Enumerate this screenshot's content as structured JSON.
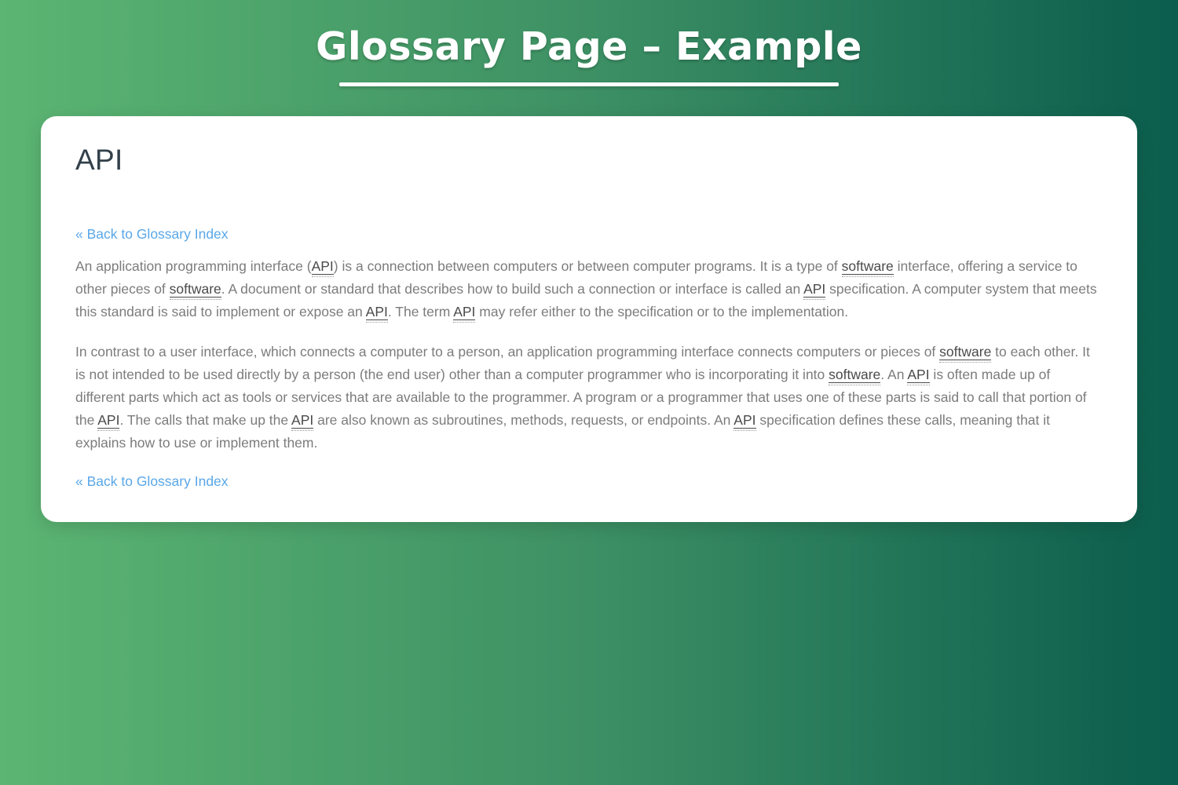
{
  "header": {
    "title": "Glossary Page – Example"
  },
  "theme": {
    "gradient_start": "#5cb572",
    "gradient_mid": "#3d9064",
    "gradient_end": "#0b5d4d",
    "card_background": "#ffffff",
    "link_color": "#5aa7e8",
    "heading_color": "#32404a",
    "body_text_color": "#7c7c7c",
    "term_color": "#4a4a4a"
  },
  "card": {
    "term": "API",
    "back_link_top": "« Back to Glossary Index",
    "back_link_bottom": "« Back to Glossary Index",
    "paragraphs": [
      {
        "segments": [
          {
            "text": "An application programming interface (",
            "term": false
          },
          {
            "text": "API",
            "term": true
          },
          {
            "text": ") is a connection between computers or between computer programs. It is a type of ",
            "term": false
          },
          {
            "text": "software",
            "term": true
          },
          {
            "text": " interface, offering a service to other pieces of ",
            "term": false
          },
          {
            "text": "software",
            "term": true
          },
          {
            "text": ". A document or standard that describes how to build such a connection or interface is called an ",
            "term": false
          },
          {
            "text": "API",
            "term": true
          },
          {
            "text": " specification. A computer system that meets this standard is said to implement or expose an ",
            "term": false
          },
          {
            "text": "API",
            "term": true
          },
          {
            "text": ". The term ",
            "term": false
          },
          {
            "text": "API",
            "term": true
          },
          {
            "text": " may refer either to the specification or to the implementation.",
            "term": false
          }
        ]
      },
      {
        "segments": [
          {
            "text": "In contrast to a user interface, which connects a computer to a person, an application programming interface connects computers or pieces of ",
            "term": false
          },
          {
            "text": "software",
            "term": true
          },
          {
            "text": " to each other. It is not intended to be used directly by a person (the end user) other than a computer programmer who is incorporating it into ",
            "term": false
          },
          {
            "text": "software",
            "term": true
          },
          {
            "text": ". An ",
            "term": false
          },
          {
            "text": "API",
            "term": true
          },
          {
            "text": " is often made up of different parts which act as tools or services that are available to the programmer. A program or a programmer that uses one of these parts is said to call that portion of the ",
            "term": false
          },
          {
            "text": "API",
            "term": true
          },
          {
            "text": ". The calls that make up the ",
            "term": false
          },
          {
            "text": "API",
            "term": true
          },
          {
            "text": " are also known as subroutines, methods, requests, or endpoints. An ",
            "term": false
          },
          {
            "text": "API",
            "term": true
          },
          {
            "text": " specification defines these calls, meaning that it explains how to use or implement them.",
            "term": false
          }
        ]
      }
    ]
  }
}
